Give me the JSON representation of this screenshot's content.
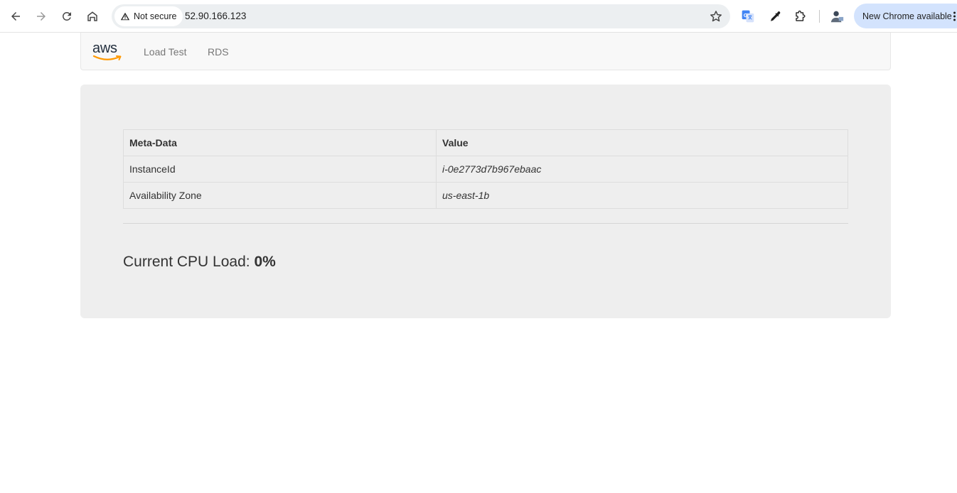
{
  "browser": {
    "security_label": "Not secure",
    "url": "52.90.166.123",
    "update_label": "New Chrome available"
  },
  "nav": {
    "logo_text": "aws",
    "links": [
      "Load Test",
      "RDS"
    ]
  },
  "meta_table": {
    "headers": [
      "Meta-Data",
      "Value"
    ],
    "rows": [
      {
        "key": "InstanceId",
        "value": "i-0e2773d7b967ebaac"
      },
      {
        "key": "Availability Zone",
        "value": "us-east-1b"
      }
    ]
  },
  "cpu": {
    "label": "Current CPU Load:",
    "value": "0%"
  },
  "colors": {
    "aws_orange": "#ff9900",
    "aws_dark": "#232f3e",
    "update_pill": "#d3e3fd"
  }
}
